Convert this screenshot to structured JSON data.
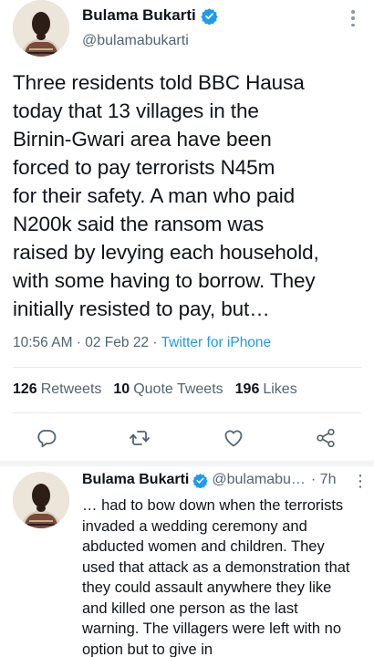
{
  "main_tweet": {
    "author_name": "Bulama Bukarti",
    "handle": "@bulamabukarti",
    "verified": true,
    "body": "Three residents told BBC Hausa\ntoday that 13 villages in the\nBirnin-Gwari area have been\nforced to pay terrorists N45m\nfor their safety. A man who paid\nN200k said the ransom was\nraised by levying each household,\nwith some having to borrow. They\ninitially resisted to pay, but…",
    "timestamp": "10:56 AM · 02 Feb 22 · ",
    "source": "Twitter for iPhone",
    "stats": {
      "retweets_count": "126",
      "retweets_label": "Retweets",
      "quotes_count": "10",
      "quotes_label": "Quote Tweets",
      "likes_count": "196",
      "likes_label": "Likes"
    },
    "actions": [
      "reply-icon",
      "retweet-icon",
      "like-icon",
      "share-icon"
    ]
  },
  "reply_tweet": {
    "author_name": "Bulama Bukarti",
    "handle": "@bulamabu…",
    "time": "· 7h",
    "verified": true,
    "body": "… had to bow down when the terrorists\ninvaded a wedding ceremony and\nabducted women and children. They\nused that attack as a demonstration that\nthey could assault anywhere they like\nand killed one person as the last\nwarning. The villagers were left with no\noption but to give in"
  },
  "colors": {
    "accent": "#1d9bf0",
    "text": "#0f1419",
    "secondary": "#536471"
  }
}
